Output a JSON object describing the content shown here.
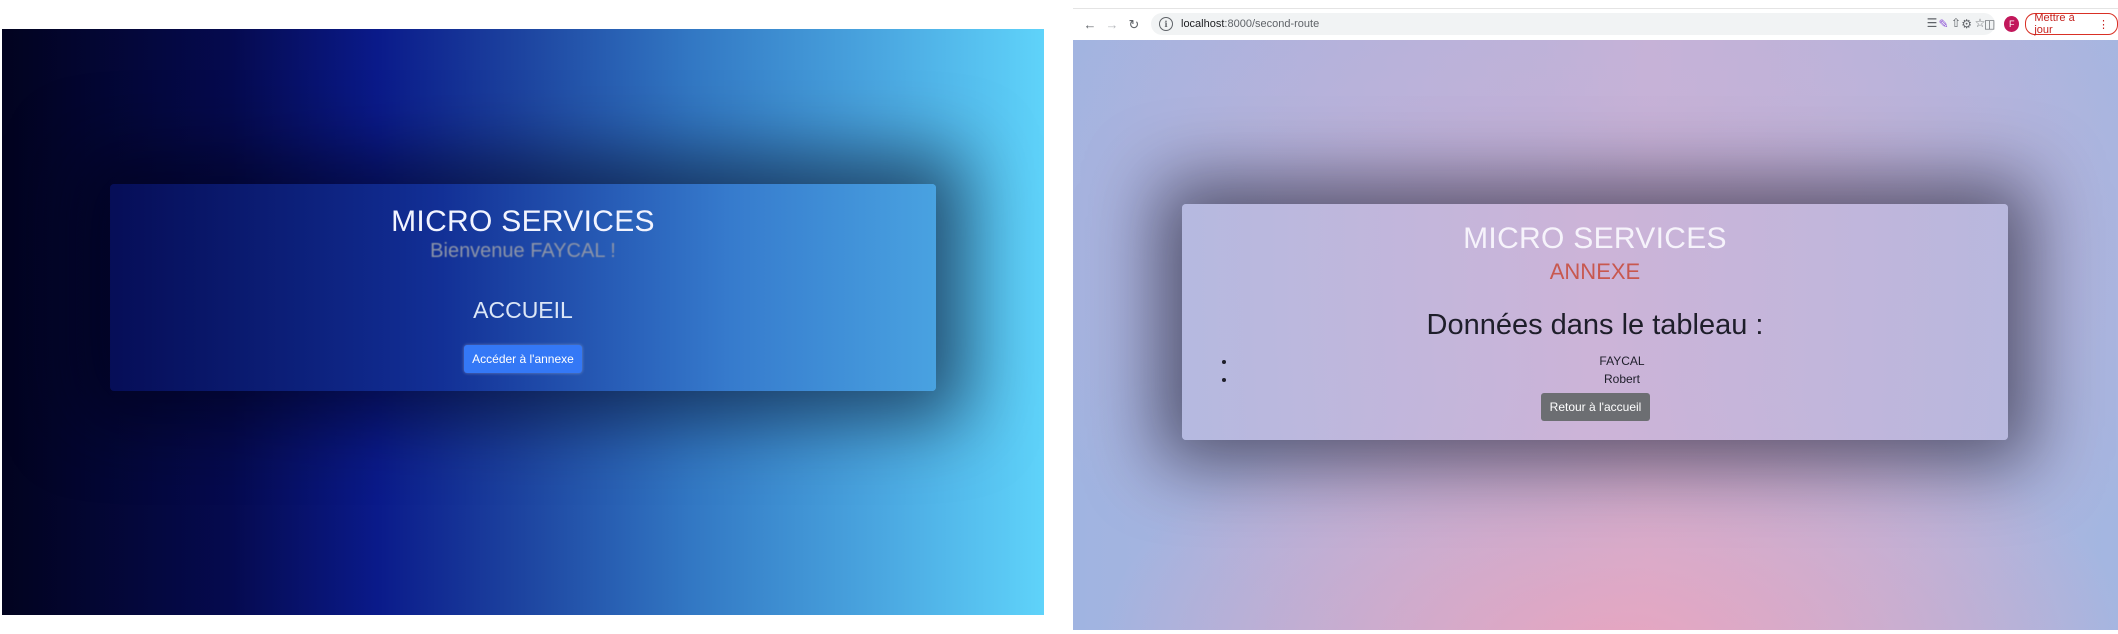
{
  "home": {
    "title": "MICRO SERVICES",
    "welcome": "Bienvenue FAYCAL !",
    "heading": "ACCUEIL",
    "button_label": "Accéder à l'annexe"
  },
  "browser": {
    "url_host": "localhost",
    "url_path": ":8000/second-route",
    "avatar_initial": "F",
    "update_label": "Mettre à jour"
  },
  "annex": {
    "title": "MICRO SERVICES",
    "subtitle": "ANNEXE",
    "heading": "Données dans le tableau :",
    "items": [
      "FAYCAL",
      "Robert"
    ],
    "button_label": "Retour à l'accueil"
  },
  "colors": {
    "primary_button": "#3478f6",
    "secondary_button": "#6c6e72",
    "annex_subtitle": "#c8584f",
    "update_accent": "#d93025"
  }
}
